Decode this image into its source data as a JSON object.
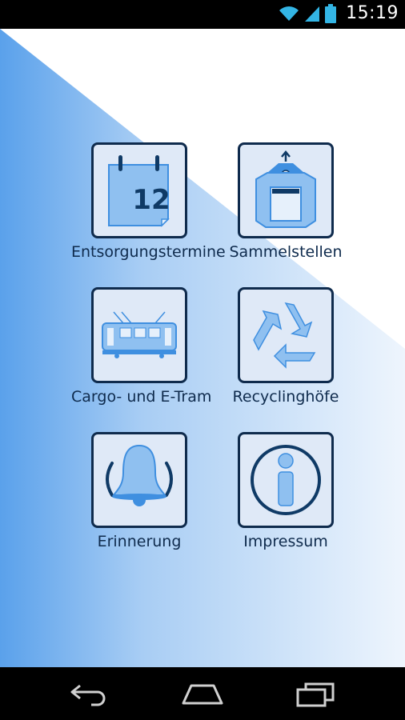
{
  "status_bar": {
    "time": "15:19",
    "icons": [
      "wifi-icon",
      "signal-icon",
      "battery-icon"
    ]
  },
  "colors": {
    "accent": "#3f8fe0",
    "border": "#0f2b4d",
    "tile_bg": "#dfe9f7",
    "icon_fill": "#8fc0f0"
  },
  "menu": {
    "items": [
      {
        "label": "Entsorgungstermine",
        "icon": "calendar-icon",
        "day": "12"
      },
      {
        "label": "Sammelstellen",
        "icon": "container-icon"
      },
      {
        "label": "Cargo- und E-Tram",
        "icon": "tram-icon"
      },
      {
        "label": "Recyclinghöfe",
        "icon": "recycle-icon"
      },
      {
        "label": "Erinnerung",
        "icon": "bell-icon"
      },
      {
        "label": "Impressum",
        "icon": "info-icon"
      }
    ]
  },
  "nav_bar": {
    "buttons": [
      "back-icon",
      "home-icon",
      "recent-apps-icon"
    ]
  }
}
